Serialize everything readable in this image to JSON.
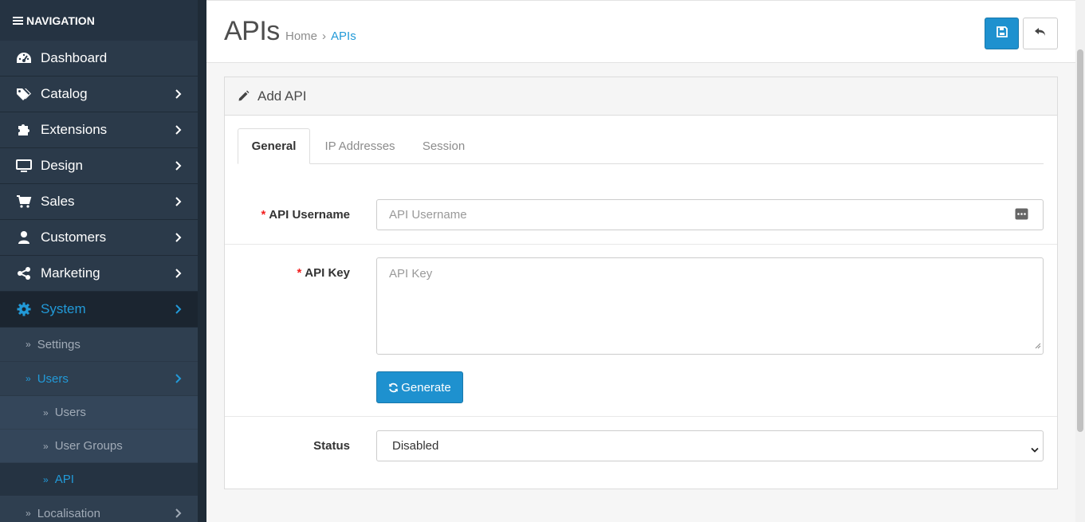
{
  "sidebar": {
    "header": "NAVIGATION",
    "items": [
      {
        "label": "Dashboard",
        "icon": "dashboard-icon",
        "chevron": false
      },
      {
        "label": "Catalog",
        "icon": "tags-icon",
        "chevron": true
      },
      {
        "label": "Extensions",
        "icon": "puzzle-icon",
        "chevron": true
      },
      {
        "label": "Design",
        "icon": "monitor-icon",
        "chevron": true
      },
      {
        "label": "Sales",
        "icon": "cart-icon",
        "chevron": true
      },
      {
        "label": "Customers",
        "icon": "user-icon",
        "chevron": true
      },
      {
        "label": "Marketing",
        "icon": "share-icon",
        "chevron": true
      },
      {
        "label": "System",
        "icon": "gear-icon",
        "chevron": true,
        "active": true
      }
    ],
    "system_sub": [
      {
        "label": "Settings"
      },
      {
        "label": "Users",
        "active": true
      },
      {
        "label": "Localisation"
      }
    ],
    "users_sub": [
      {
        "label": "Users"
      },
      {
        "label": "User Groups"
      },
      {
        "label": "API",
        "active": true
      }
    ]
  },
  "header": {
    "title": "APIs",
    "breadcrumb": {
      "home": "Home",
      "separator": "›",
      "current": "APIs"
    }
  },
  "panel": {
    "title": "Add API",
    "tabs": [
      {
        "label": "General",
        "active": true
      },
      {
        "label": "IP Addresses"
      },
      {
        "label": "Session"
      }
    ],
    "form": {
      "username_label": "API Username",
      "username_placeholder": "API Username",
      "key_label": "API Key",
      "key_placeholder": "API Key",
      "generate_label": "Generate",
      "status_label": "Status",
      "status_value": "Disabled",
      "required_mark": "*"
    }
  },
  "colors": {
    "accent": "#229ad8",
    "button_primary": "#1e91cf",
    "sidebar_bg": "#2b3a4a",
    "required": "#f21e1e"
  }
}
